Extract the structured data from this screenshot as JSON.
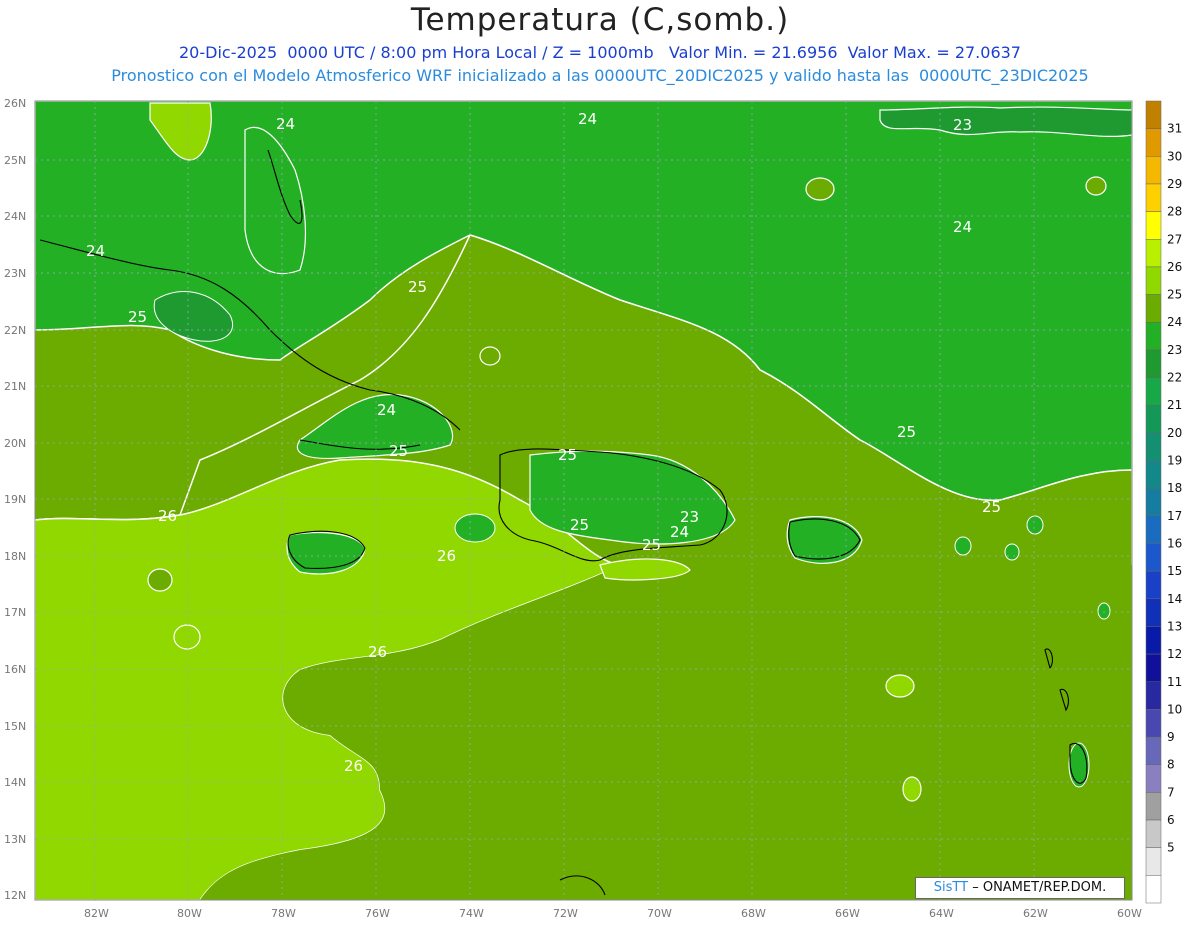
{
  "header": {
    "title": "Temperatura (C,somb.)",
    "subtitle_line1": "20-Dic-2025  0000 UTC / 8:00 pm Hora Local / Z = 1000mb   Valor Min. = 21.6956  Valor Max. = 27.0637",
    "subtitle_line2": "Pronostico con el Modelo Atmosferico WRF inicializado a las 0000UTC_20DIC2025 y valido hasta las  0000UTC_23DIC2025"
  },
  "map": {
    "lat_labels": [
      "26N",
      "25N",
      "24N",
      "23N",
      "22N",
      "21N",
      "20N",
      "19N",
      "18N",
      "17N",
      "16N",
      "15N",
      "14N",
      "13N",
      "12N"
    ],
    "lon_labels": [
      "82W",
      "80W",
      "78W",
      "76W",
      "74W",
      "72W",
      "70W",
      "68W",
      "66W",
      "64W",
      "62W",
      "60W"
    ],
    "contour_labels": [
      {
        "text": "24",
        "id": "c1"
      },
      {
        "text": "24",
        "id": "c2"
      },
      {
        "text": "23",
        "id": "c3"
      },
      {
        "text": "24",
        "id": "c4"
      },
      {
        "text": "24",
        "id": "c5"
      },
      {
        "text": "25",
        "id": "c6"
      },
      {
        "text": "25",
        "id": "c7"
      },
      {
        "text": "24",
        "id": "c8"
      },
      {
        "text": "25",
        "id": "c9"
      },
      {
        "text": "25",
        "id": "c10"
      },
      {
        "text": "25",
        "id": "c11"
      },
      {
        "text": "26",
        "id": "c12"
      },
      {
        "text": "26",
        "id": "c13"
      },
      {
        "text": "25",
        "id": "c14"
      },
      {
        "text": "23",
        "id": "c15"
      },
      {
        "text": "24",
        "id": "c16"
      },
      {
        "text": "25",
        "id": "c17"
      },
      {
        "text": "25",
        "id": "c18"
      },
      {
        "text": "26",
        "id": "c19"
      },
      {
        "text": "26",
        "id": "c20"
      }
    ]
  },
  "colorbar": {
    "levels": [
      "31",
      "30",
      "29",
      "28",
      "27",
      "26",
      "25",
      "24",
      "23",
      "22",
      "21",
      "20",
      "19",
      "18",
      "17",
      "16",
      "15",
      "14",
      "13",
      "12",
      "11",
      "10",
      "9",
      "8",
      "7",
      "6",
      "5"
    ],
    "colors": [
      "#c08000",
      "#e09a00",
      "#f5b800",
      "#ffd000",
      "#ffff00",
      "#b8f000",
      "#90d800",
      "#6cab00",
      "#24b024",
      "#1e9a30",
      "#18a848",
      "#139858",
      "#138f72",
      "#128888",
      "#157ea0",
      "#1a6cc0",
      "#1c58cc",
      "#1a40c8",
      "#1030b8",
      "#0a1aa8",
      "#10109a",
      "#2828a0",
      "#4848b0",
      "#6868b8",
      "#8a80c0",
      "#a0a0a0",
      "#c8c8c8",
      "#e8e8e8",
      "#ffffff"
    ]
  },
  "credit": {
    "logo": "SisTT",
    "text": "– ONAMET/REP.DOM."
  }
}
